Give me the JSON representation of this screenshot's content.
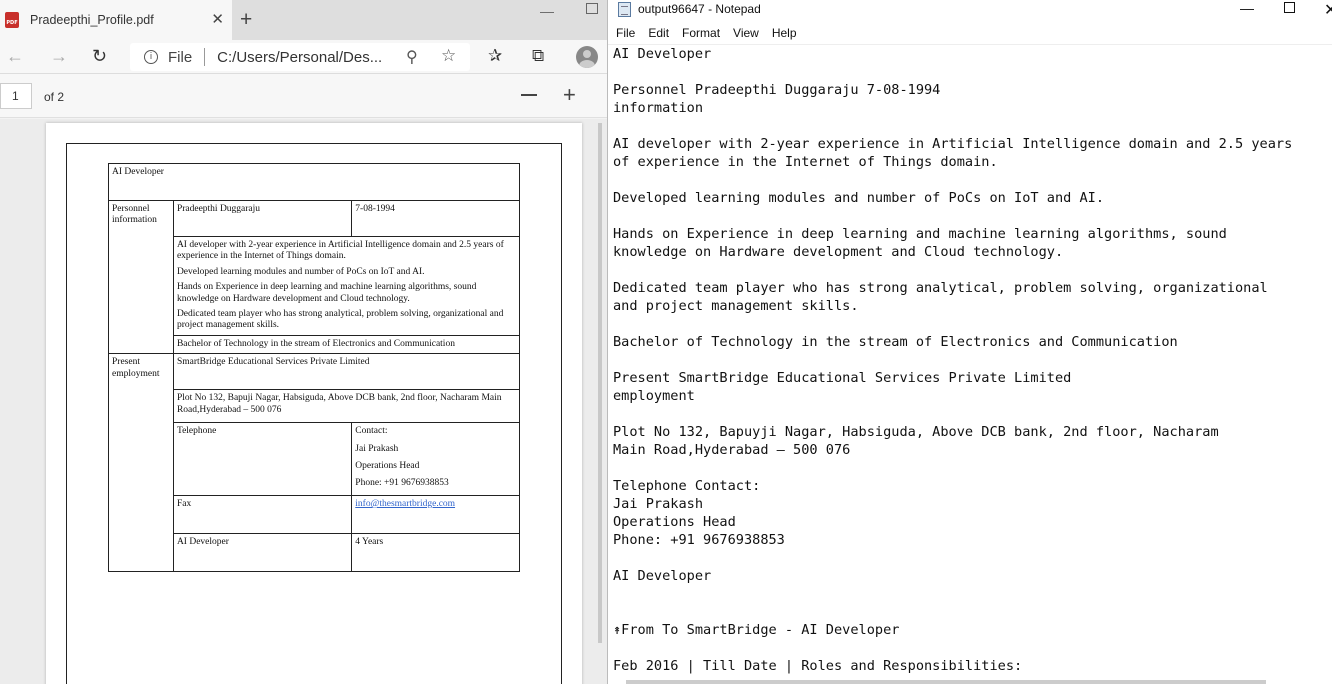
{
  "browser": {
    "tab_title": "Pradeepthi_Profile.pdf",
    "tab_close": "✕",
    "new_tab": "+",
    "address_scheme": "File",
    "address_url": "C:/Users/Personal/Des...",
    "page_number": "1",
    "page_of": "of 2"
  },
  "resume": {
    "title": "AI Developer",
    "personnel_label": "Personnel information",
    "name": "Pradeepthi Duggaraju",
    "dob": "7-08-1994",
    "summary": [
      "AI developer with 2-year experience in Artificial Intelligence domain and 2.5 years of experience in the Internet of Things domain.",
      "Developed learning modules and number of PoCs on IoT and AI.",
      "Hands on Experience in deep learning and machine learning algorithms, sound knowledge on Hardware development and Cloud technology.",
      "Dedicated team player who has strong analytical, problem solving, organizational and project management skills."
    ],
    "education": "Bachelor of Technology in the stream of Electronics and Communication",
    "present_label": "Present employment",
    "company": "SmartBridge Educational Services Private Limited",
    "address": "Plot No 132, Bapuji Nagar, Habsiguda, Above DCB bank, 2nd floor, Nacharam Main Road,Hyderabad – 500 076",
    "telephone_label": "Telephone",
    "contact_label": "Contact:",
    "contact_name": "Jai Prakash",
    "contact_role": "Operations Head",
    "contact_phone": "Phone: +91 9676938853",
    "fax_label": "Fax",
    "email": "info@thesmartbridge.com",
    "role": "AI Developer",
    "years": "4 Years"
  },
  "notepad": {
    "title": "output96647 - Notepad",
    "menu": [
      "File",
      "Edit",
      "Format",
      "View",
      "Help"
    ],
    "content": "AI Developer\n\nPersonnel Pradeepthi Duggaraju 7-08-1994\ninformation\n\nAI developer with 2-year experience in Artificial Intelligence domain and 2.5 years\nof experience in the Internet of Things domain.\n\nDeveloped learning modules and number of PoCs on IoT and AI.\n\nHands on Experience in deep learning and machine learning algorithms, sound\nknowledge on Hardware development and Cloud technology.\n\nDedicated team player who has strong analytical, problem solving, organizational\nand project management skills.\n\nBachelor of Technology in the stream of Electronics and Communication\n\nPresent SmartBridge Educational Services Private Limited\nemployment\n\nPlot No 132, Bapuyji Nagar, Habsiguda, Above DCB bank, 2nd floor, Nacharam\nMain Road,Hyderabad – 500 076\n\nTelephone Contact:\nJai Prakash\nOperations Head\nPhone: +91 9676938853\n\nAI Developer\n\n\n↟From To SmartBridge - AI Developer\n\nFeb 2016 | Till Date | Roles and Responsibilities:"
  }
}
